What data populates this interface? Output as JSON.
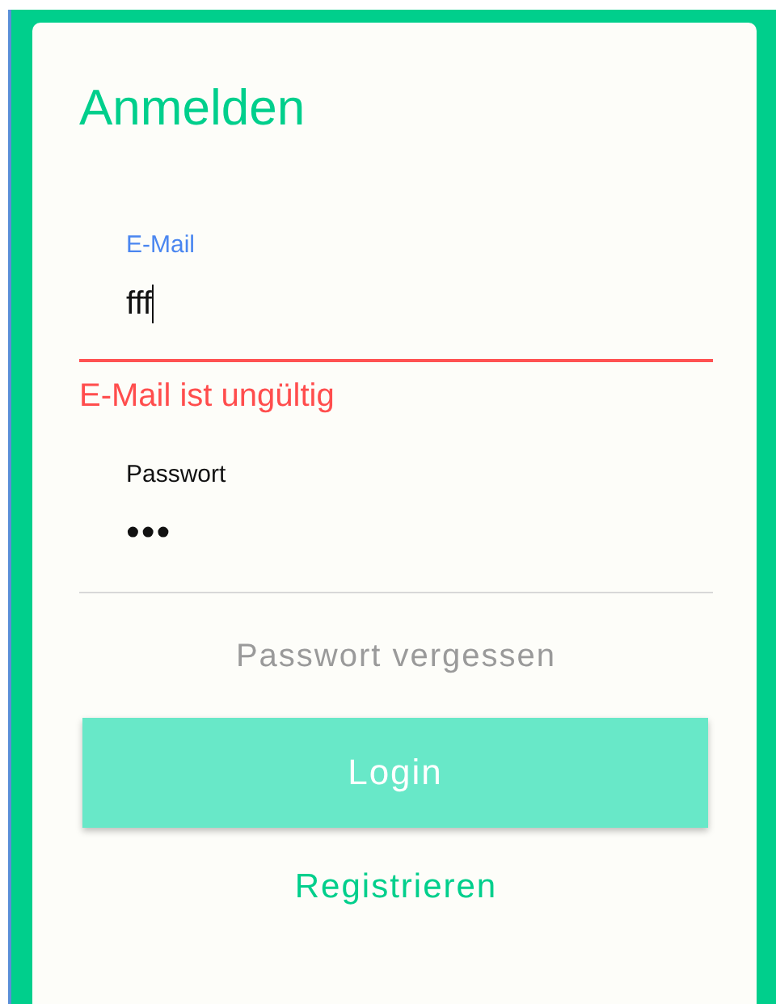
{
  "title": "Anmelden",
  "fields": [
    {
      "kind": "email",
      "label": "E-Mail",
      "value": "fff",
      "focused": true,
      "error": "E-Mail ist ungültig"
    },
    {
      "kind": "password",
      "label": "Passwort",
      "value": "•••",
      "focused": false
    }
  ],
  "forgot_link": "Passwort vergessen",
  "login_button": {
    "label": "Login"
  },
  "register_link": "Registrieren"
}
